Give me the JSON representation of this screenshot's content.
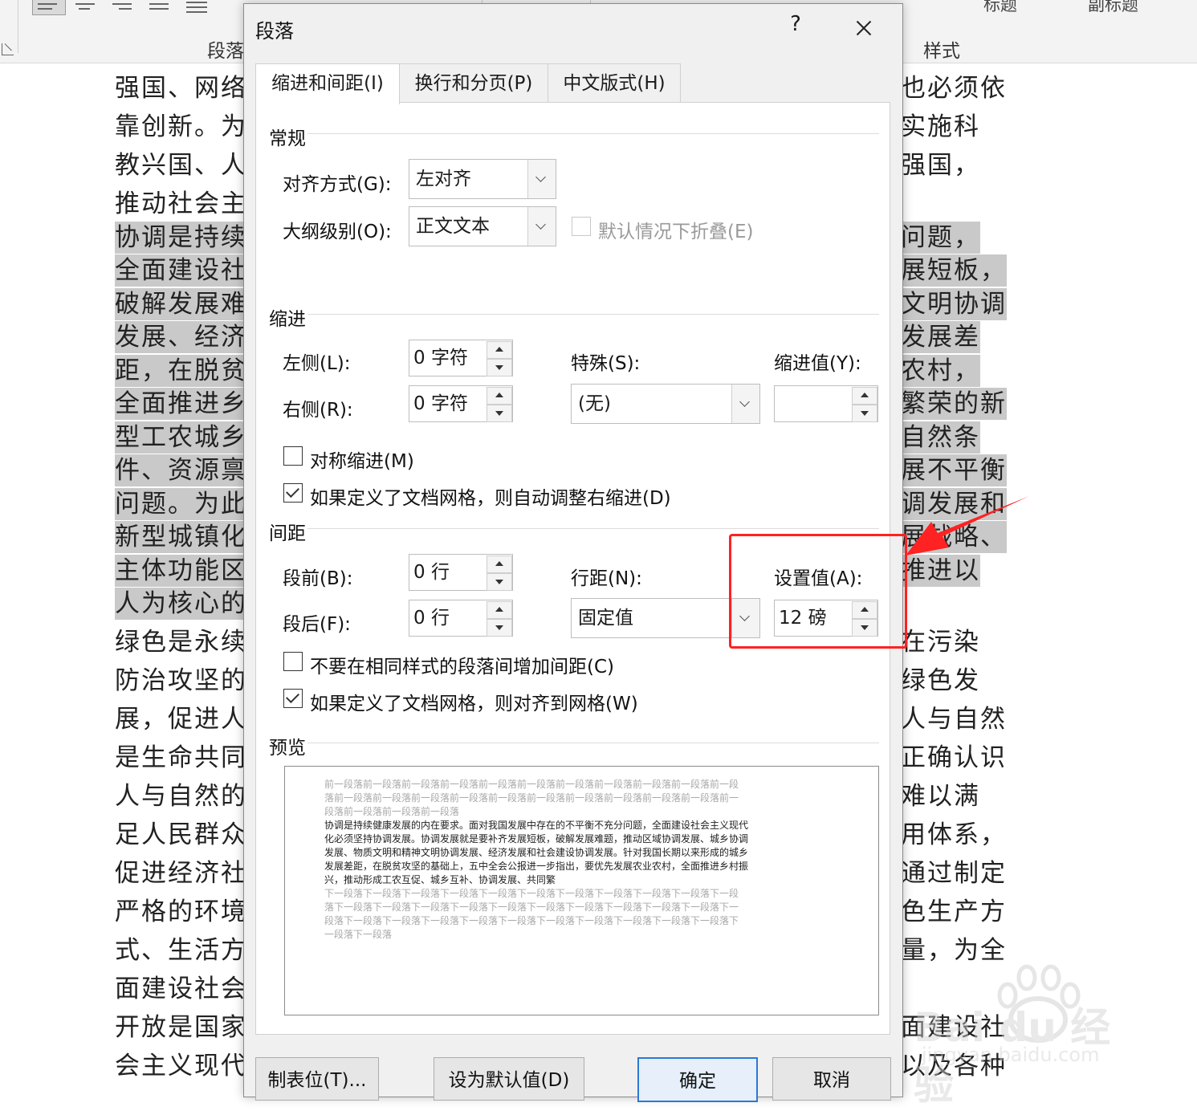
{
  "ribbon": {
    "paragraph_group_label": "段落",
    "styles_group_label": "样式",
    "style_names": [
      "标题",
      "副标题"
    ]
  },
  "document": {
    "left_lines": [
      "强国、网络",
      "靠创新。为",
      "教兴国、人",
      "推动社会主",
      "协调是持续",
      "全面建设社",
      "破解发展难",
      "发展、经济",
      "距，在脱贫",
      "全面推进乡",
      "型工农城乡",
      "件、资源禀",
      "问题。为此",
      "新型城镇化",
      "主体功能区",
      "人为核心的",
      "绿色是永续",
      "防治攻坚的",
      "展，促进人",
      "是生命共同",
      "人与自然的",
      "足人民群众",
      "促进经济社",
      "严格的环境",
      "式、生活方",
      "面建设社会",
      "开放是国家",
      "会主义现代"
    ],
    "right_lines": [
      "也必须依",
      "实施科",
      "强国，",
      "",
      "问题，",
      "展短板，",
      "文明协调",
      "发展差",
      "农村，",
      "繁荣的新",
      "自然条",
      "展不平衡",
      "调发展和",
      "展战略、",
      "推进以",
      "",
      "在污染",
      "绿色发",
      "人与自然",
      "正确认识",
      "难以满",
      "用体系，",
      "通过制定",
      "色生产方",
      "量，为全",
      "",
      "面建设社",
      "以及各种"
    ]
  },
  "dialog": {
    "title": "段落",
    "help": "?",
    "tabs": [
      "缩进和间距(I)",
      "换行和分页(P)",
      "中文版式(H)"
    ],
    "general": {
      "section": "常规",
      "alignment_label": "对齐方式(G):",
      "alignment_value": "左对齐",
      "outline_label": "大纲级别(O):",
      "outline_value": "正文文本",
      "collapse_label": "默认情况下折叠(E)"
    },
    "indent": {
      "section": "缩进",
      "left_label": "左侧(L):",
      "left_value": "0 字符",
      "right_label": "右侧(R):",
      "right_value": "0 字符",
      "special_label": "特殊(S):",
      "special_value": "(无)",
      "by_label": "缩进值(Y):",
      "by_value": "",
      "mirror_label": "对称缩进(M)",
      "mirror_checked": false,
      "auto_adjust_label": "如果定义了文档网格，则自动调整右缩进(D)",
      "auto_adjust_checked": true
    },
    "spacing": {
      "section": "间距",
      "before_label": "段前(B):",
      "before_value": "0 行",
      "after_label": "段后(F):",
      "after_value": "0 行",
      "line_spacing_label": "行距(N):",
      "line_spacing_value": "固定值",
      "at_label": "设置值(A):",
      "at_value": "12 磅",
      "no_space_label": "不要在相同样式的段落间增加间距(C)",
      "no_space_checked": false,
      "snap_grid_label": "如果定义了文档网格，则对齐到网格(W)",
      "snap_grid_checked": true
    },
    "preview": {
      "section": "预览",
      "before_text": [
        "前一段落前一段落前一段落前一段落前一段落前一段落前一段落前一段落前一段落前一段落前一段",
        "落前一段落前一段落前一段落前一段落前一段落前一段落前一段落前一段落前一段落前一段落前一",
        "段落前一段落前一段落前一段落"
      ],
      "main_text": [
        "协调是持续健康发展的内在要求。面对我国发展中存在的不平衡不充分问题，全面建设社会主义现代",
        "化必须坚持协调发展。协调发展就是要补齐发展短板，破解发展难题，推动区域协调发展、城乡协调",
        "发展、物质文明和精神文明协调发展、经济发展和社会建设协调发展。针对我国长期以来形成的城乡",
        "发展差距，在脱贫攻坚的基础上，五中全会公报进一步指出，要优先发展农业农村，全面推进乡村振",
        "兴，推动形成工农互促、城乡互补、协调发展、共同繁"
      ],
      "after_text": [
        "下一段落下一段落下一段落下一段落下一段落下一段落下一段落下一段落下一段落下一段落下一段",
        "落下一段落下一段落下一段落下一段落下一段落下一段落下一段落下一段落下一段落下一段落下一",
        "段落下一段落下一段落下一段落下一段落下一段落下一段落下一段落下一段落下一段落下一段落下",
        "一段落下一段落"
      ]
    },
    "buttons": {
      "tabs": "制表位(T)...",
      "set_default": "设为默认值(D)",
      "ok": "确定",
      "cancel": "取消"
    }
  },
  "annotation": {
    "color": "#ff2222"
  },
  "watermark": {
    "brand": "Bai du 经验",
    "url": "jingyan.baidu.com"
  }
}
